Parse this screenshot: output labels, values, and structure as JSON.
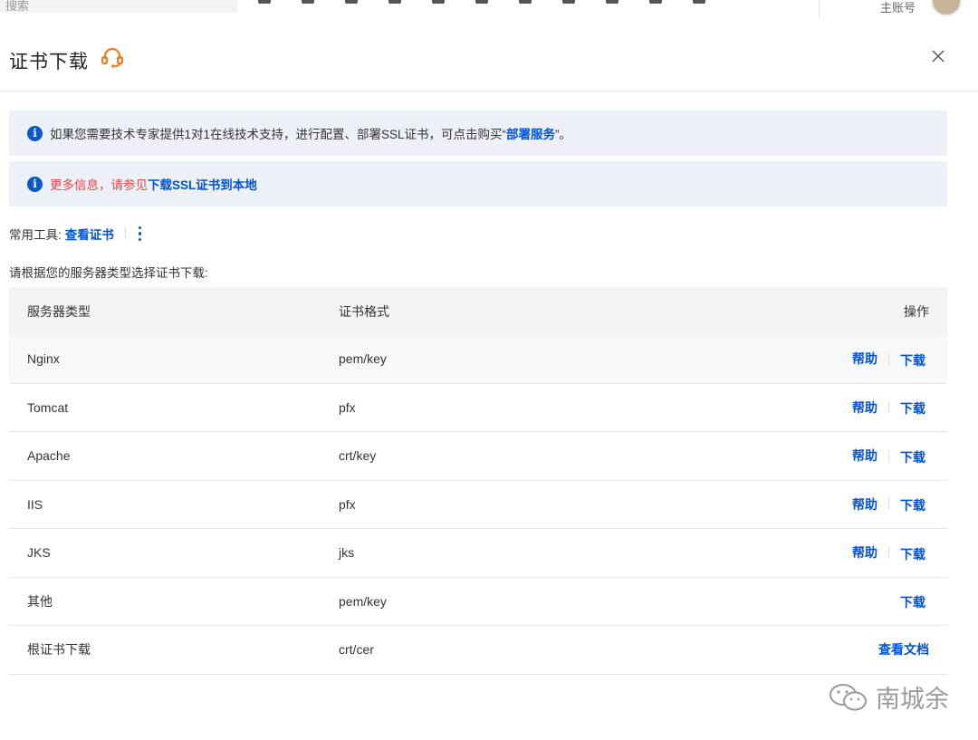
{
  "topbar": {
    "search_placeholder": "搜索",
    "account_label": "主账号"
  },
  "header": {
    "title": "证书下载"
  },
  "notices": {
    "notice1": {
      "text_before": "如果您需要技术专家提供1对1在线技术支持，进行配置、部署SSL证书，可点击购买“",
      "link": "部署服务",
      "text_after": "”。"
    },
    "notice2": {
      "red_text": "更多信息，请参见",
      "link": "下载SSL证书到本地"
    }
  },
  "tools": {
    "label": "常用工具:",
    "link": "查看证书"
  },
  "subtitle": "请根据您的服务器类型选择证书下载:",
  "table": {
    "headers": [
      "服务器类型",
      "证书格式",
      "操作"
    ],
    "rows": [
      {
        "server": "Nginx",
        "format": "pem/key",
        "help": "帮助",
        "download": "下载"
      },
      {
        "server": "Tomcat",
        "format": "pfx",
        "help": "帮助",
        "download": "下载"
      },
      {
        "server": "Apache",
        "format": "crt/key",
        "help": "帮助",
        "download": "下载"
      },
      {
        "server": "IIS",
        "format": "pfx",
        "help": "帮助",
        "download": "下载"
      },
      {
        "server": "JKS",
        "format": "jks",
        "help": "帮助",
        "download": "下载"
      },
      {
        "server": "其他",
        "format": "pem/key",
        "download": "下载"
      },
      {
        "server": "根证书下载",
        "format": "crt/cer",
        "doc": "查看文档"
      }
    ]
  },
  "watermark": "南城余",
  "colors": {
    "link": "#0052d9",
    "info_icon": "#0a58ca",
    "notice_bg": "#edf1f7",
    "red": "#e54545",
    "support_icon": "#f07c1f"
  }
}
